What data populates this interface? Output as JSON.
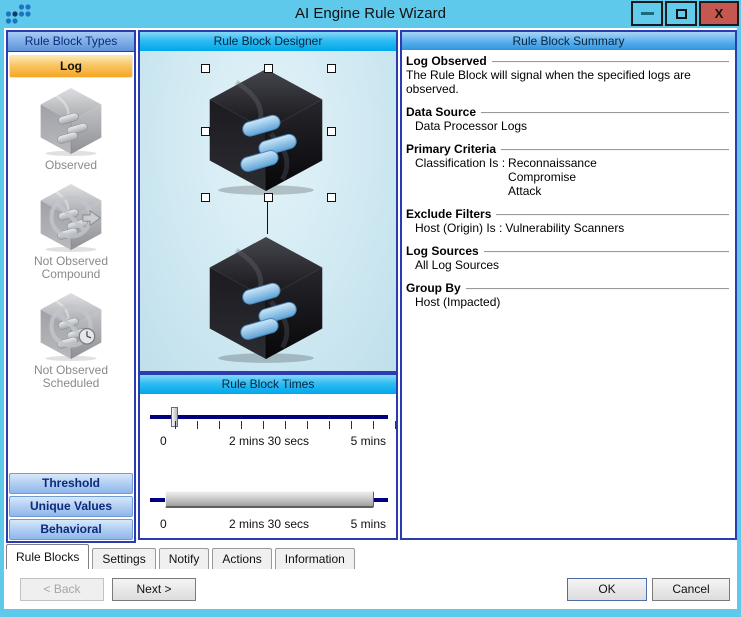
{
  "window": {
    "title": "AI Engine Rule Wizard"
  },
  "icons": {
    "logo": "dots-grid",
    "minimize": "dash",
    "maximize": "square",
    "close_glyph": "X"
  },
  "left_panel": {
    "header": "Rule Block Types",
    "log_button": "Log",
    "items": [
      {
        "icon": "cube-observed-icon",
        "label": "Observed"
      },
      {
        "icon": "cube-not-observed-compound-icon",
        "label": "Not Observed Compound"
      },
      {
        "icon": "cube-not-observed-scheduled-icon",
        "label": "Not Observed Scheduled"
      }
    ],
    "type_buttons": [
      "Threshold",
      "Unique Values",
      "Behavioral"
    ]
  },
  "designer": {
    "header": "Rule Block Designer",
    "times_header": "Rule Block Times",
    "sliders": [
      {
        "labels": [
          "0",
          "2 mins 30 secs",
          "5 mins"
        ],
        "thumb_position": "0"
      },
      {
        "labels": [
          "0",
          "2 mins 30 secs",
          "5 mins"
        ],
        "range": "full"
      }
    ]
  },
  "summary": {
    "header": "Rule Block Summary",
    "sections": [
      {
        "heading": "Log Observed",
        "body": "The Rule Block will signal when the specified logs are observed."
      },
      {
        "heading": "Data Source",
        "body": "Data Processor Logs"
      },
      {
        "heading": "Primary Criteria",
        "label": "Classification Is :",
        "values": [
          "Reconnaissance",
          "Compromise",
          "Attack"
        ]
      },
      {
        "heading": "Exclude Filters",
        "label": "Host (Origin) Is :",
        "values": [
          "Vulnerability Scanners"
        ]
      },
      {
        "heading": "Log Sources",
        "body": "All Log Sources"
      },
      {
        "heading": "Group By",
        "body": "Host (Impacted)"
      }
    ]
  },
  "tabs": {
    "items": [
      "Rule Blocks",
      "Settings",
      "Notify",
      "Actions",
      "Information"
    ],
    "active": "Rule Blocks"
  },
  "footer": {
    "back": "< Back",
    "next": "Next >",
    "ok": "OK",
    "cancel": "Cancel"
  },
  "colors": {
    "titlebar": "#5ec9ea",
    "panel_border": "#2a3cb0",
    "cyan_header": "#00a7ec",
    "summary_header": "#2e96e0",
    "log_button_orange": "#f5a623",
    "slider_track_navy": "#00007f",
    "close_button_red": "#c4574f"
  }
}
